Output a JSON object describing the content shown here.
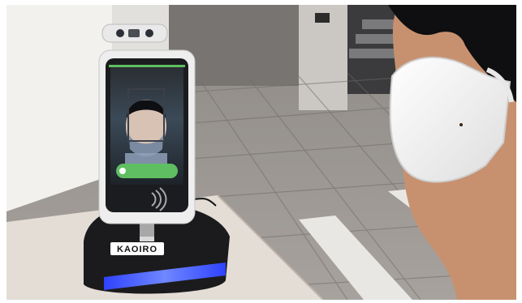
{
  "scene": {
    "device_brand": "KAOIRO",
    "palette": {
      "floor_light": "#bdb7b1",
      "floor_dark": "#8f8a86",
      "tile_line": "#6f6b67",
      "wall": "#ecebe8",
      "stand": "#202022",
      "blue_light": "#3a5cff",
      "mask": "#f4f4f2",
      "skin": "#c8906f",
      "hair": "#0f0e10",
      "screen_green": "#5fbe61"
    }
  }
}
